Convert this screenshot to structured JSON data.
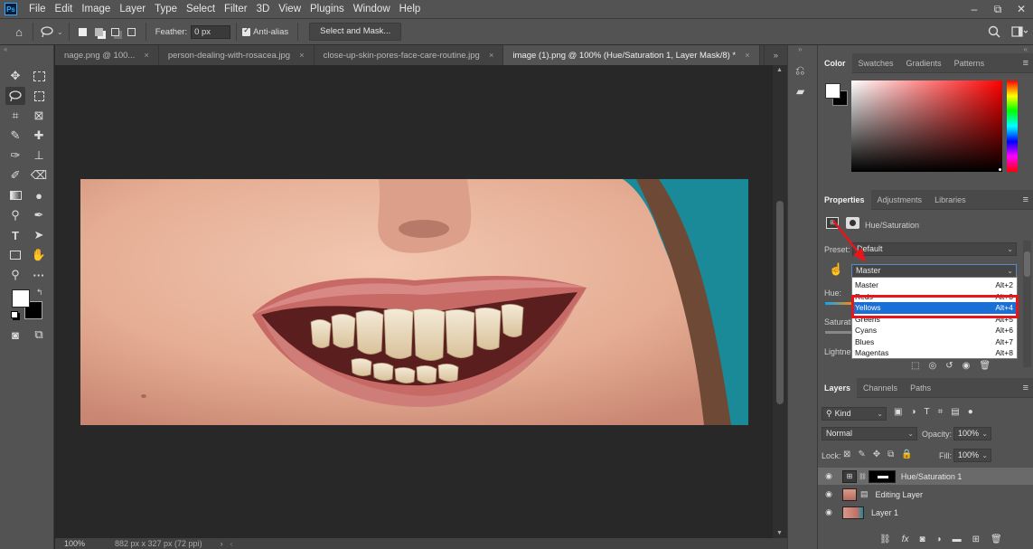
{
  "menu": {
    "app_logo": "Ps",
    "items": [
      "File",
      "Edit",
      "Image",
      "Layer",
      "Type",
      "Select",
      "Filter",
      "3D",
      "View",
      "Plugins",
      "Window",
      "Help"
    ],
    "window_buttons": [
      "–",
      "⧉",
      "✕"
    ]
  },
  "options_bar": {
    "feather_label": "Feather:",
    "feather_value": "0 px",
    "antialias_label": "Anti-alias",
    "select_mask_label": "Select and Mask..."
  },
  "tabs": [
    {
      "label": "nage.png @ 100...",
      "active": false
    },
    {
      "label": "person-dealing-with-rosacea.jpg",
      "active": false
    },
    {
      "label": "close-up-skin-pores-face-care-routine.jpg",
      "active": false
    },
    {
      "label": "image (1).png @ 100% (Hue/Saturation 1, Layer Mask/8) *",
      "active": true
    }
  ],
  "tab_overflow": "»",
  "status": {
    "zoom": "100%",
    "dimensions": "882 px x 327 px (72 ppi)"
  },
  "color_panel": {
    "tabs": [
      "Color",
      "Swatches",
      "Gradients",
      "Patterns"
    ],
    "active": "Color",
    "hue_color": "#ff0000"
  },
  "properties_panel": {
    "tabs": [
      "Properties",
      "Adjustments",
      "Libraries"
    ],
    "active": "Properties",
    "adjustment_name": "Hue/Saturation",
    "preset_label": "Preset:",
    "preset_value": "Default",
    "channel_value": "Master",
    "hue_label": "Hue:",
    "saturation_label": "Saturation:",
    "lightness_label": "Lightness:"
  },
  "channel_dropdown": {
    "items": [
      {
        "label": "Master",
        "shortcut": "Alt+2"
      },
      {
        "label": "Reds",
        "shortcut": "Alt+3"
      },
      {
        "label": "Yellows",
        "shortcut": "Alt+4",
        "selected": true
      },
      {
        "label": "Greens",
        "shortcut": "Alt+5"
      },
      {
        "label": "Cyans",
        "shortcut": "Alt+6"
      },
      {
        "label": "Blues",
        "shortcut": "Alt+7"
      },
      {
        "label": "Magentas",
        "shortcut": "Alt+8"
      }
    ],
    "highlight_color": "#e8151b"
  },
  "layers_panel": {
    "tabs": [
      "Layers",
      "Channels",
      "Paths"
    ],
    "active": "Layers",
    "filter_label": "Kind",
    "blend_mode": "Normal",
    "opacity_label": "Opacity:",
    "opacity_value": "100%",
    "lock_label": "Lock:",
    "fill_label": "Fill:",
    "fill_value": "100%",
    "layers": [
      {
        "name": "Hue/Saturation 1",
        "selected": true
      },
      {
        "name": "Editing Layer",
        "selected": false
      },
      {
        "name": "Layer 1",
        "selected": false
      }
    ]
  },
  "colors": {
    "accent_red": "#e8151b",
    "selection_blue": "#1a6fd6",
    "teal_bg": "#1a8a98"
  }
}
